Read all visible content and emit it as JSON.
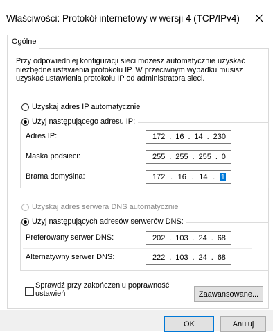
{
  "window": {
    "title": "Właściwości: Protokół internetowy w wersji 4 (TCP/IPv4)",
    "close_icon": "close-icon"
  },
  "tabs": [
    {
      "label": "Ogólne",
      "active": true
    }
  ],
  "description": "Przy odpowiedniej konfiguracji sieci możesz automatycznie uzyskać niezbędne ustawienia protokołu IP. W przeciwnym wypadku musisz uzyskać ustawienia protokołu IP od administratora sieci.",
  "ip_mode": {
    "auto_label": "Uzyskaj adres IP automatycznie",
    "auto_selected": false,
    "manual_label": "Użyj następującego adresu IP:",
    "manual_selected": true
  },
  "ip_fields": [
    {
      "label": "Adres IP:",
      "octets": [
        "172",
        "16",
        "14",
        "230"
      ]
    },
    {
      "label": "Maska podsieci:",
      "octets": [
        "255",
        "255",
        "255",
        "0"
      ]
    },
    {
      "label": "Brama domyślna:",
      "octets": [
        "172",
        "16",
        "14",
        "1"
      ],
      "selected_octet": 3
    }
  ],
  "dns_mode": {
    "auto_label": "Uzyskaj adres serwera DNS automatycznie",
    "auto_enabled": false,
    "manual_label": "Użyj następujących adresów serwerów DNS:",
    "manual_selected": true
  },
  "dns_fields": [
    {
      "label": "Preferowany serwer DNS:",
      "octets": [
        "202",
        "103",
        "24",
        "68"
      ]
    },
    {
      "label": "Alternatywny serwer DNS:",
      "octets": [
        "222",
        "103",
        "24",
        "68"
      ]
    }
  ],
  "validate": {
    "label": "Sprawdź przy zakończeniu poprawność ustawień",
    "checked": false
  },
  "buttons": {
    "advanced": "Zaawansowane...",
    "ok": "OK",
    "cancel": "Anuluj"
  },
  "colors": {
    "accent": "#0078d7",
    "footer": "#f0f0f0"
  }
}
